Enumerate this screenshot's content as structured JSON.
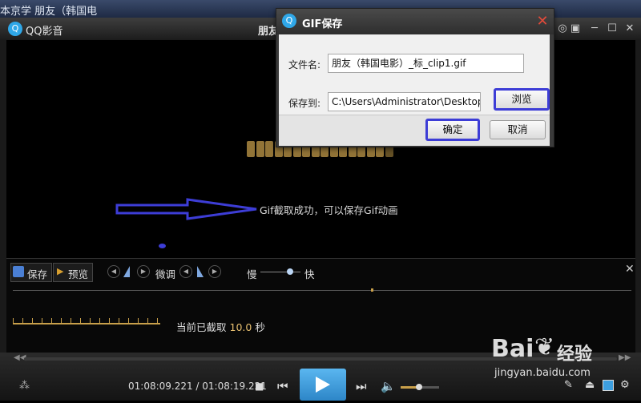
{
  "window": {
    "app_title": "QQ影音",
    "video_title": "朋友",
    "top_strip_text": "本京学 朋友（韩国电",
    "icons": [
      "pin-icon",
      "menu-icon",
      "minimize-icon",
      "maximize-icon",
      "close-icon"
    ]
  },
  "overlay": {
    "success_message": "Gif截取成功，可以保存Gif动画"
  },
  "dialog": {
    "title": "GIF保存",
    "filename_label": "文件名:",
    "filename_value": "朋友（韩国电影）_标_clip1.gif",
    "save_to_label": "保存到:",
    "save_to_value": "C:\\Users\\Administrator\\Desktop",
    "browse_label": "浏览",
    "confirm_label": "确定",
    "cancel_label": "取消",
    "highlight_color": "#3d3dd6"
  },
  "gif_panel": {
    "save_label": "保存",
    "preview_label": "预览",
    "fine_tune_label": "微调",
    "slow_label": "慢",
    "fast_label": "快",
    "captured_prefix": "当前已截取",
    "captured_value": "10.0",
    "captured_unit": "秒"
  },
  "player": {
    "time_text": "01:08:09.221 / 01:08:19.221",
    "accent_color": "#3d9fe0"
  },
  "watermark": {
    "brand": "Bai",
    "product": "经验",
    "url": "jingyan.baidu.com"
  }
}
